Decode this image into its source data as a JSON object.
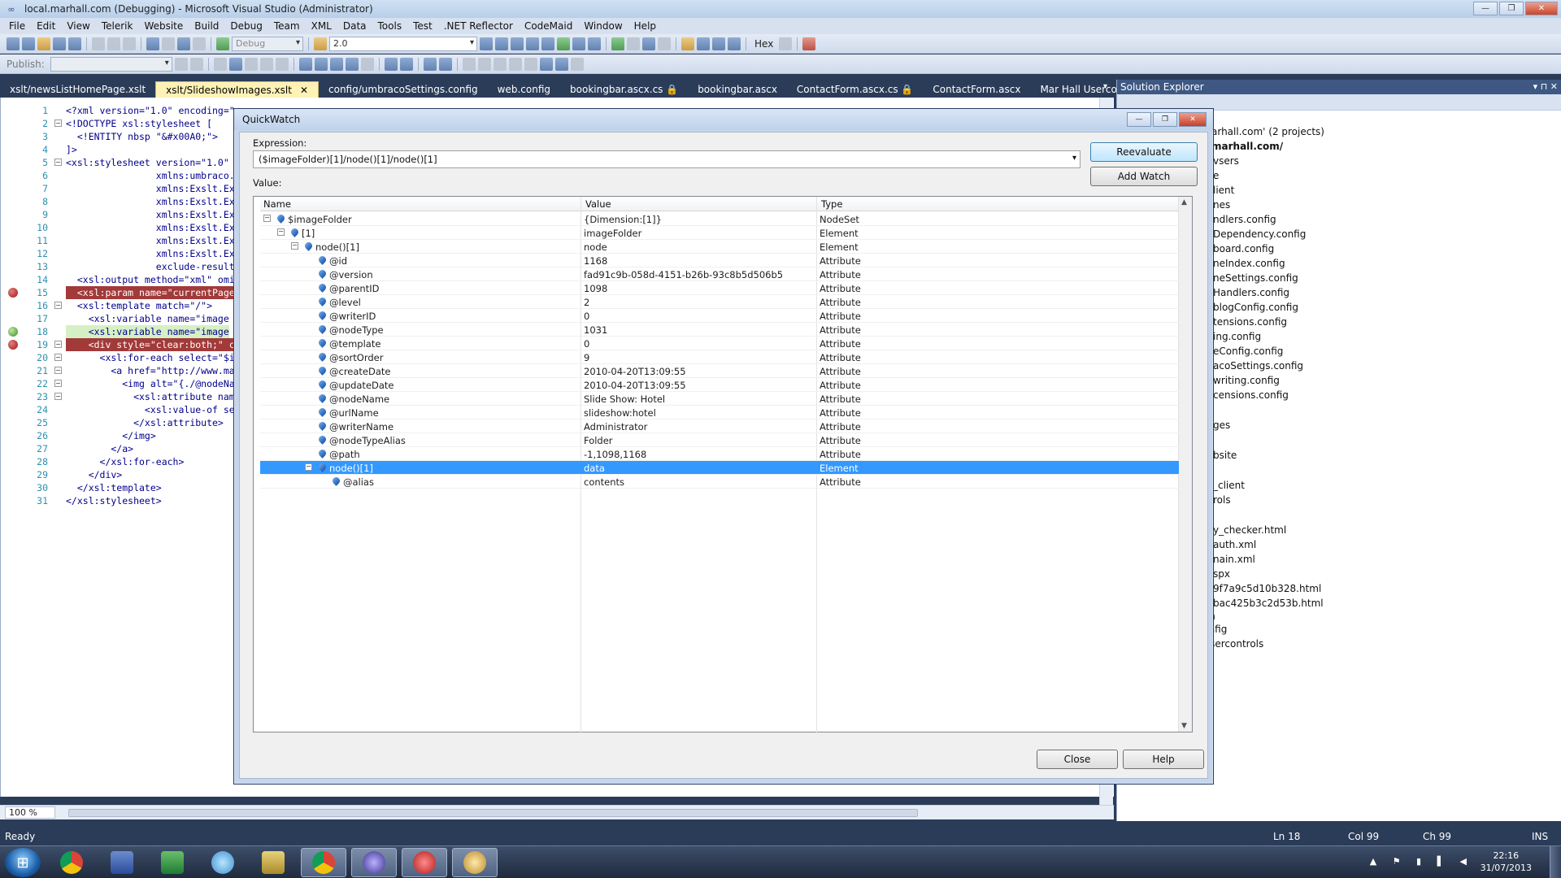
{
  "window": {
    "title": "local.marhall.com (Debugging) - Microsoft Visual Studio (Administrator)",
    "controls": [
      "—",
      "❐",
      "✕"
    ]
  },
  "menu": [
    "File",
    "Edit",
    "View",
    "Telerik",
    "Website",
    "Build",
    "Debug",
    "Team",
    "XML",
    "Data",
    "Tools",
    "Test",
    ".NET Reflector",
    "CodeMaid",
    "Window",
    "Help"
  ],
  "toolbar": {
    "config_combo": "Debug",
    "version_combo": "2.0",
    "hex_label": "Hex",
    "publish_label": "Publish:"
  },
  "tabs": [
    {
      "label": "xslt/newsListHomePage.xslt",
      "active": false
    },
    {
      "label": "xslt/SlideshowImages.xslt",
      "active": true
    },
    {
      "label": "config/umbracoSettings.config",
      "active": false
    },
    {
      "label": "web.config",
      "active": false
    },
    {
      "label": "bookingbar.ascx.cs 🔒",
      "active": false
    },
    {
      "label": "bookingbar.ascx",
      "active": false
    },
    {
      "label": "ContactForm.ascx.cs 🔒",
      "active": false
    },
    {
      "label": "ContactForm.ascx",
      "active": false
    },
    {
      "label": "Mar Hall Usercontrols",
      "active": false
    }
  ],
  "tabs_close": "✕",
  "editor": {
    "lines": [
      {
        "n": "1",
        "text": "<?xml version=\"1.0\" encoding=\"",
        "fold": ""
      },
      {
        "n": "2",
        "text": "<!DOCTYPE xsl:stylesheet [",
        "fold": "−"
      },
      {
        "n": "3",
        "text": "  <!ENTITY nbsp \"&#x00A0;\">",
        "fold": ""
      },
      {
        "n": "4",
        "text": "]>",
        "fold": ""
      },
      {
        "n": "5",
        "text": "<xsl:stylesheet version=\"1.0\"",
        "fold": "−"
      },
      {
        "n": "6",
        "text": "                xmlns:umbraco.",
        "fold": ""
      },
      {
        "n": "7",
        "text": "                xmlns:Exslt.Ex",
        "fold": ""
      },
      {
        "n": "8",
        "text": "                xmlns:Exslt.Ex",
        "fold": ""
      },
      {
        "n": "9",
        "text": "                xmlns:Exslt.Ex",
        "fold": ""
      },
      {
        "n": "10",
        "text": "                xmlns:Exslt.Ex",
        "fold": ""
      },
      {
        "n": "11",
        "text": "                xmlns:Exslt.Ex",
        "fold": ""
      },
      {
        "n": "12",
        "text": "                xmlns:Exslt.Ex",
        "fold": ""
      },
      {
        "n": "13",
        "text": "                exclude-result",
        "fold": ""
      },
      {
        "n": "14",
        "text": "  <xsl:output method=\"xml\" omi",
        "fold": ""
      },
      {
        "n": "15",
        "text": "  <xsl:param name=\"currentPage",
        "fold": "",
        "hl": "red",
        "bp": "red"
      },
      {
        "n": "16",
        "text": "  <xsl:template match=\"/\">",
        "fold": "−"
      },
      {
        "n": "17",
        "text": "    <xsl:variable name=\"image",
        "fold": ""
      },
      {
        "n": "18",
        "text": "    <xsl:variable name=\"image",
        "fold": "",
        "hl": "green",
        "bp": "green"
      },
      {
        "n": "19",
        "text": "    <div style=\"clear:both;\" c",
        "fold": "−",
        "hl": "red",
        "bp": "red"
      },
      {
        "n": "20",
        "text": "      <xsl:for-each select=\"$i",
        "fold": "−"
      },
      {
        "n": "21",
        "text": "        <a href=\"http://www.ma",
        "fold": "−"
      },
      {
        "n": "22",
        "text": "          <img alt=\"{./@nodeNa",
        "fold": "−"
      },
      {
        "n": "23",
        "text": "            <xsl:attribute nam",
        "fold": "−"
      },
      {
        "n": "24",
        "text": "              <xsl:value-of se",
        "fold": ""
      },
      {
        "n": "25",
        "text": "            </xsl:attribute>",
        "fold": ""
      },
      {
        "n": "26",
        "text": "          </img>",
        "fold": ""
      },
      {
        "n": "27",
        "text": "        </a>",
        "fold": ""
      },
      {
        "n": "28",
        "text": "      </xsl:for-each>",
        "fold": ""
      },
      {
        "n": "29",
        "text": "    </div>",
        "fold": ""
      },
      {
        "n": "30",
        "text": "  </xsl:template>",
        "fold": ""
      },
      {
        "n": "31",
        "text": "</xsl:stylesheet>",
        "fold": ""
      }
    ],
    "zoom": "100 %"
  },
  "solution_explorer": {
    "title": "Solution Explorer",
    "title_btns": "▾ ⊓ ✕",
    "items": [
      "arhall.com' (2 projects)",
      "marhall.com/",
      "vsers",
      "e",
      "lient",
      "nes",
      "ndlers.config",
      "Dependency.config",
      "board.config",
      "neIndex.config",
      "neSettings.config",
      "Handlers.config",
      "blogConfig.config",
      "tensions.config",
      "ing.config",
      "eConfig.config",
      "acoSettings.config",
      "writing.config",
      "censions.config",
      "ges",
      "bsite",
      "_client",
      "rols",
      "y_checker.html",
      "auth.xml",
      "nain.xml",
      "spx",
      "9f7a9c5d10b328.html",
      "bac425b3c2d53b.html",
      "test.htm",
      "web.config",
      "Mar Hall Usercontrols"
    ]
  },
  "quickwatch": {
    "title": "QuickWatch",
    "expression_label": "Expression:",
    "expression_value": "($imageFolder)[1]/node()[1]/node()[1]",
    "value_label": "Value:",
    "reevaluate": "Reevaluate",
    "add_watch": "Add Watch",
    "close": "Close",
    "help": "Help",
    "columns": [
      "Name",
      "Value",
      "Type"
    ],
    "rows": [
      {
        "indent": 0,
        "exp": "−",
        "name": "$imageFolder",
        "value": "{Dimension:[1]}",
        "type": "NodeSet"
      },
      {
        "indent": 1,
        "exp": "−",
        "name": "[1]",
        "value": "imageFolder",
        "type": "Element"
      },
      {
        "indent": 2,
        "exp": "−",
        "name": "node()[1]",
        "value": "node",
        "type": "Element"
      },
      {
        "indent": 3,
        "exp": "",
        "name": "@id",
        "value": "1168",
        "type": "Attribute"
      },
      {
        "indent": 3,
        "exp": "",
        "name": "@version",
        "value": "fad91c9b-058d-4151-b26b-93c8b5d506b5",
        "type": "Attribute"
      },
      {
        "indent": 3,
        "exp": "",
        "name": "@parentID",
        "value": "1098",
        "type": "Attribute"
      },
      {
        "indent": 3,
        "exp": "",
        "name": "@level",
        "value": "2",
        "type": "Attribute"
      },
      {
        "indent": 3,
        "exp": "",
        "name": "@writerID",
        "value": "0",
        "type": "Attribute"
      },
      {
        "indent": 3,
        "exp": "",
        "name": "@nodeType",
        "value": "1031",
        "type": "Attribute"
      },
      {
        "indent": 3,
        "exp": "",
        "name": "@template",
        "value": "0",
        "type": "Attribute"
      },
      {
        "indent": 3,
        "exp": "",
        "name": "@sortOrder",
        "value": "9",
        "type": "Attribute"
      },
      {
        "indent": 3,
        "exp": "",
        "name": "@createDate",
        "value": "2010-04-20T13:09:55",
        "type": "Attribute"
      },
      {
        "indent": 3,
        "exp": "",
        "name": "@updateDate",
        "value": "2010-04-20T13:09:55",
        "type": "Attribute"
      },
      {
        "indent": 3,
        "exp": "",
        "name": "@nodeName",
        "value": "Slide Show: Hotel",
        "type": "Attribute"
      },
      {
        "indent": 3,
        "exp": "",
        "name": "@urlName",
        "value": "slideshow:hotel",
        "type": "Attribute"
      },
      {
        "indent": 3,
        "exp": "",
        "name": "@writerName",
        "value": "Administrator",
        "type": "Attribute"
      },
      {
        "indent": 3,
        "exp": "",
        "name": "@nodeTypeAlias",
        "value": "Folder",
        "type": "Attribute"
      },
      {
        "indent": 3,
        "exp": "",
        "name": "@path",
        "value": "-1,1098,1168",
        "type": "Attribute"
      },
      {
        "indent": 3,
        "exp": "−",
        "name": "node()[1]",
        "value": "data",
        "type": "Element",
        "selected": true
      },
      {
        "indent": 4,
        "exp": "",
        "name": "@alias",
        "value": "contents",
        "type": "Attribute"
      }
    ]
  },
  "status": {
    "left": "Ready",
    "ln": "Ln 18",
    "col": "Col 99",
    "ch": "Ch 99",
    "ins": "INS"
  },
  "taskbar": {
    "time": "22:16",
    "date": "31/07/2013"
  }
}
